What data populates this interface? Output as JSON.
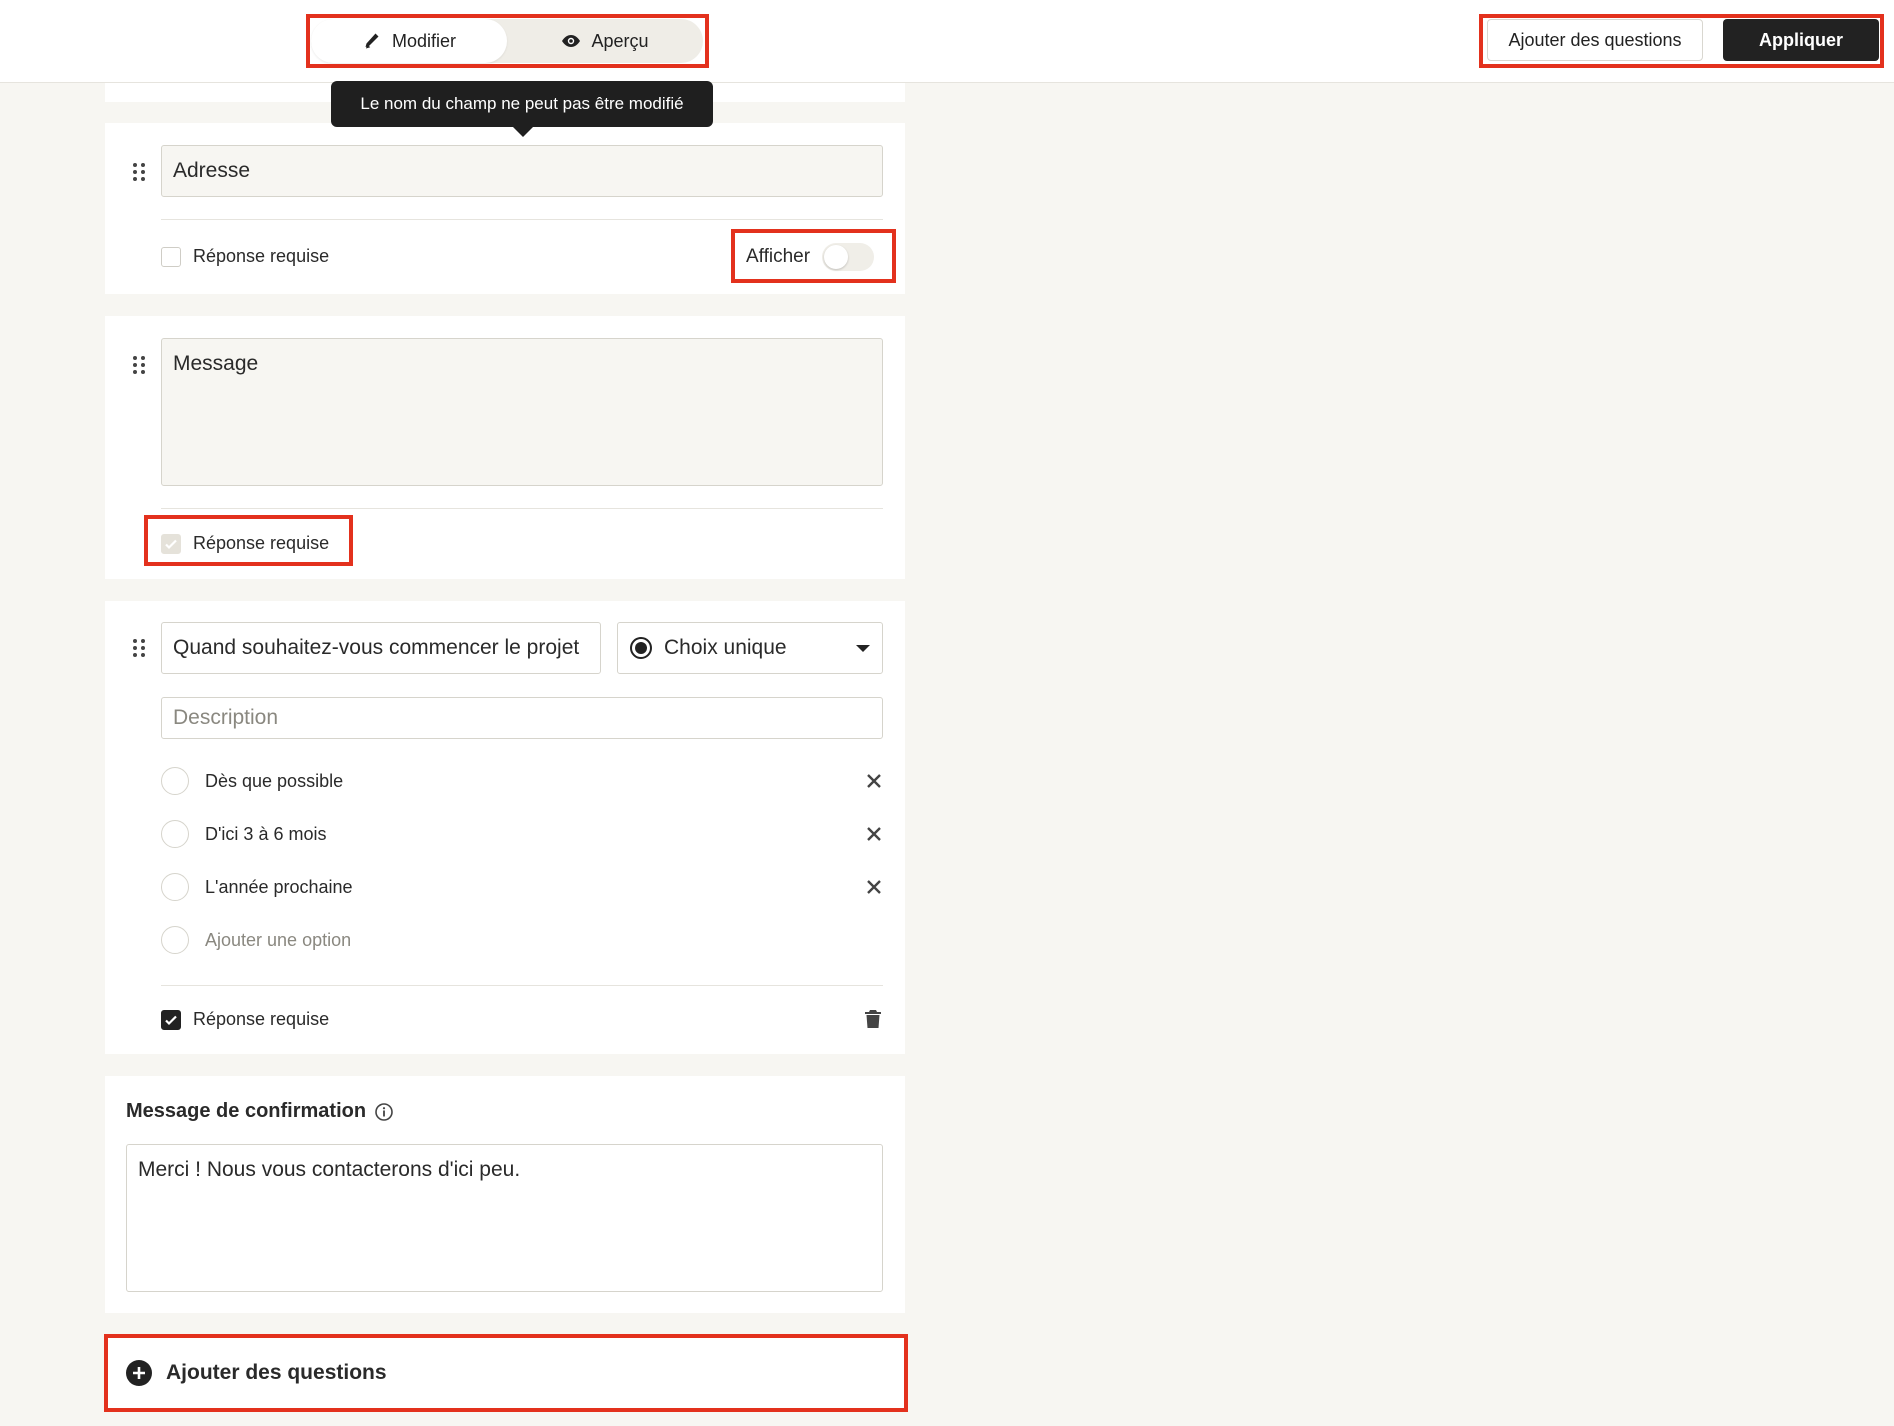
{
  "topbar": {
    "edit_label": "Modifier",
    "preview_label": "Aperçu",
    "add_questions_label": "Ajouter des questions",
    "apply_label": "Appliquer"
  },
  "tooltip": {
    "text": "Le nom du champ ne peut pas être modifié"
  },
  "fields": {
    "address": {
      "label": "Adresse",
      "required_label": "Réponse requise",
      "required": false,
      "show_label": "Afficher",
      "show": false
    },
    "message": {
      "label": "Message",
      "required_label": "Réponse requise",
      "required": true,
      "disabled": true
    },
    "question": {
      "text": "Quand souhaitez-vous commencer le projet",
      "type_label": "Choix unique",
      "description_placeholder": "Description",
      "options": [
        "Dès que possible",
        "D'ici 3 à 6 mois",
        "L'année prochaine"
      ],
      "add_option_label": "Ajouter une option",
      "required_label": "Réponse requise",
      "required": true
    }
  },
  "confirmation": {
    "title": "Message de confirmation",
    "message": "Merci ! Nous vous contacterons d'ici peu."
  },
  "add_questions": {
    "label": "Ajouter des questions"
  },
  "colors": {
    "annotation": "#e3311d",
    "dark": "#222222",
    "background": "#f7f6f2"
  },
  "icons": [
    "pencil-icon",
    "eye-icon",
    "drag-handle-icon",
    "radio-icon",
    "chevron-down-icon",
    "close-icon",
    "trash-icon",
    "info-icon",
    "plus-circle-icon",
    "check-icon"
  ]
}
